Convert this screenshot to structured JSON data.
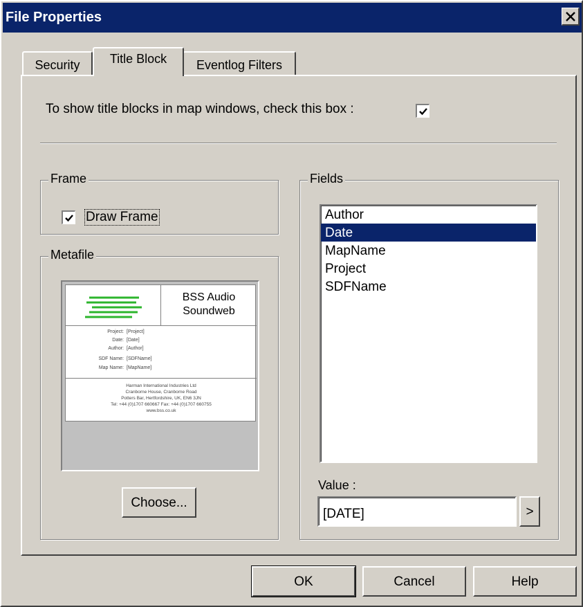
{
  "window": {
    "title": "File Properties"
  },
  "tabs": [
    {
      "label": "Security"
    },
    {
      "label": "Title Block"
    },
    {
      "label": "Eventlog Filters"
    }
  ],
  "active_tab": "Title Block",
  "show_title_blocks": {
    "label": "To show title blocks in map windows, check this box :",
    "checked": true
  },
  "frame": {
    "group_label": "Frame",
    "draw_frame_label": "Draw Frame",
    "draw_frame_checked": true
  },
  "metafile": {
    "group_label": "Metafile",
    "preview": {
      "brand_line1": "BSS Audio",
      "brand_line2": "Soundweb",
      "fields": [
        {
          "key": "Project:",
          "value": "[Project]"
        },
        {
          "key": "Date:",
          "value": "[Date]"
        },
        {
          "key": "Author:",
          "value": "[Author]"
        },
        {
          "key": "SDF Name:",
          "value": "[SDFName]"
        },
        {
          "key": "Map Name:",
          "value": "[MapName]"
        }
      ],
      "address": [
        "Harman International Industries Ltd",
        "Cranborne House, Cranborne Road",
        "Potters Bar, Hertfordshire, UK, EN6 3JN",
        "Tel: +44 (0)1707 660667    Fax: +44 (0)1707 660755",
        "www.bss.co.uk"
      ],
      "logo_color": "#2cb52c"
    },
    "choose_label": "Choose..."
  },
  "fields": {
    "group_label": "Fields",
    "items": [
      "Author",
      "Date",
      "MapName",
      "Project",
      "SDFName"
    ],
    "selected": "Date",
    "value_label": "Value :",
    "value": "[DATE]",
    "arrow_label": ">"
  },
  "buttons": {
    "ok": "OK",
    "cancel": "Cancel",
    "help": "Help"
  },
  "colors": {
    "face": "#d4d0c8",
    "titlebar": "#0a246a",
    "selection": "#0a246a"
  }
}
